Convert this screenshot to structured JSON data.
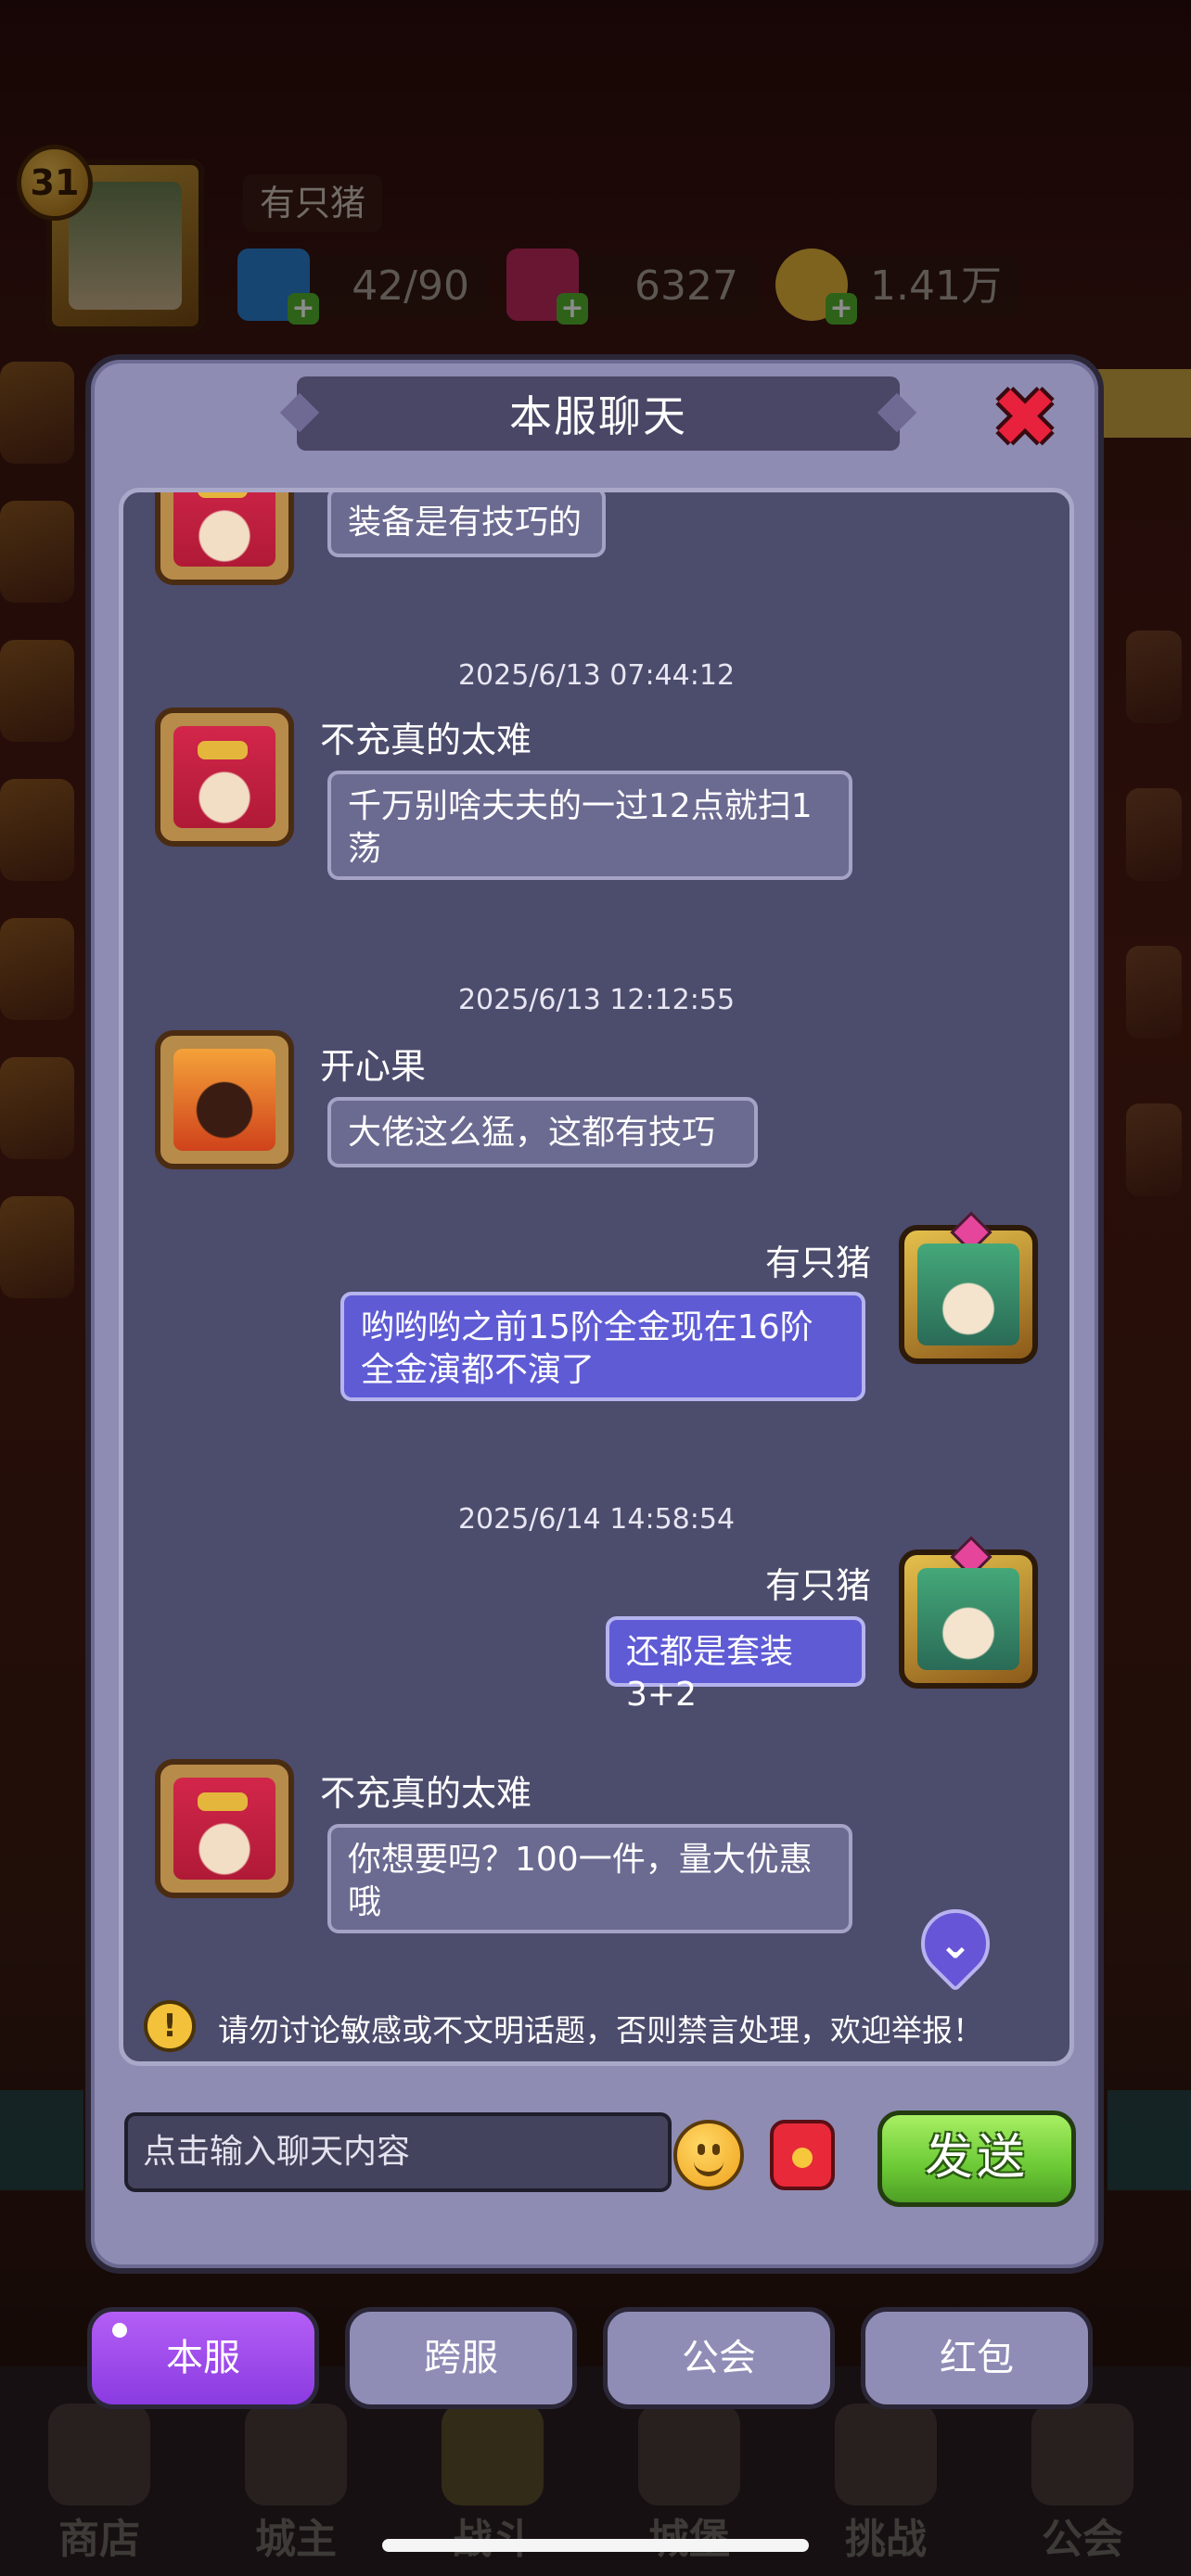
{
  "player": {
    "level": "31",
    "name": "有只猪",
    "stamina": "42/90",
    "gems": "6327",
    "gold": "1.41万"
  },
  "dialog": {
    "title": "本服聊天",
    "messages": [
      {
        "type": "other",
        "text": "装备是有技巧的",
        "avatar": "red-hair-avatar"
      },
      {
        "type": "time",
        "text": "2025/6/13 07:44:12"
      },
      {
        "type": "other",
        "sender": "不充真的太难",
        "text": "千万别啥夫夫的一过12点就扫1荡",
        "avatar": "red-hair-avatar"
      },
      {
        "type": "time",
        "text": "2025/6/13 12:12:55"
      },
      {
        "type": "other",
        "sender": "开心果",
        "text": "大佬这么猛，这都有技巧",
        "avatar": "fire-warrior-avatar"
      },
      {
        "type": "me",
        "sender": "有只猪",
        "text": "哟哟哟之前15阶全金现在16阶全金演都不演了",
        "avatar": "green-hair-avatar"
      },
      {
        "type": "time",
        "text": "2025/6/14 14:58:54"
      },
      {
        "type": "me",
        "sender": "有只猪",
        "text": "还都是套装3+2",
        "avatar": "green-hair-avatar"
      },
      {
        "type": "other",
        "sender": "不充真的太难",
        "text": "你想要吗？100一件，量大优惠哦",
        "avatar": "red-hair-avatar"
      }
    ],
    "warning": "请勿讨论敏感或不文明话题，否则禁言处理，欢迎举报！",
    "input_placeholder": "点击输入聊天内容",
    "send_label": "发送"
  },
  "tabs": [
    "本服",
    "跨服",
    "公会",
    "红包"
  ],
  "bottom_nav": [
    "商店",
    "城主",
    "战斗",
    "城堡",
    "挑战",
    "公会"
  ],
  "colors": {
    "dialog_bg": "#8e8cb3",
    "chat_panel": "#4c4c6d",
    "bubble_other": "#6b6a91",
    "bubble_me": "#5f5bd5",
    "send_green": "#6bc935",
    "active_tab": "#9b47e8"
  }
}
